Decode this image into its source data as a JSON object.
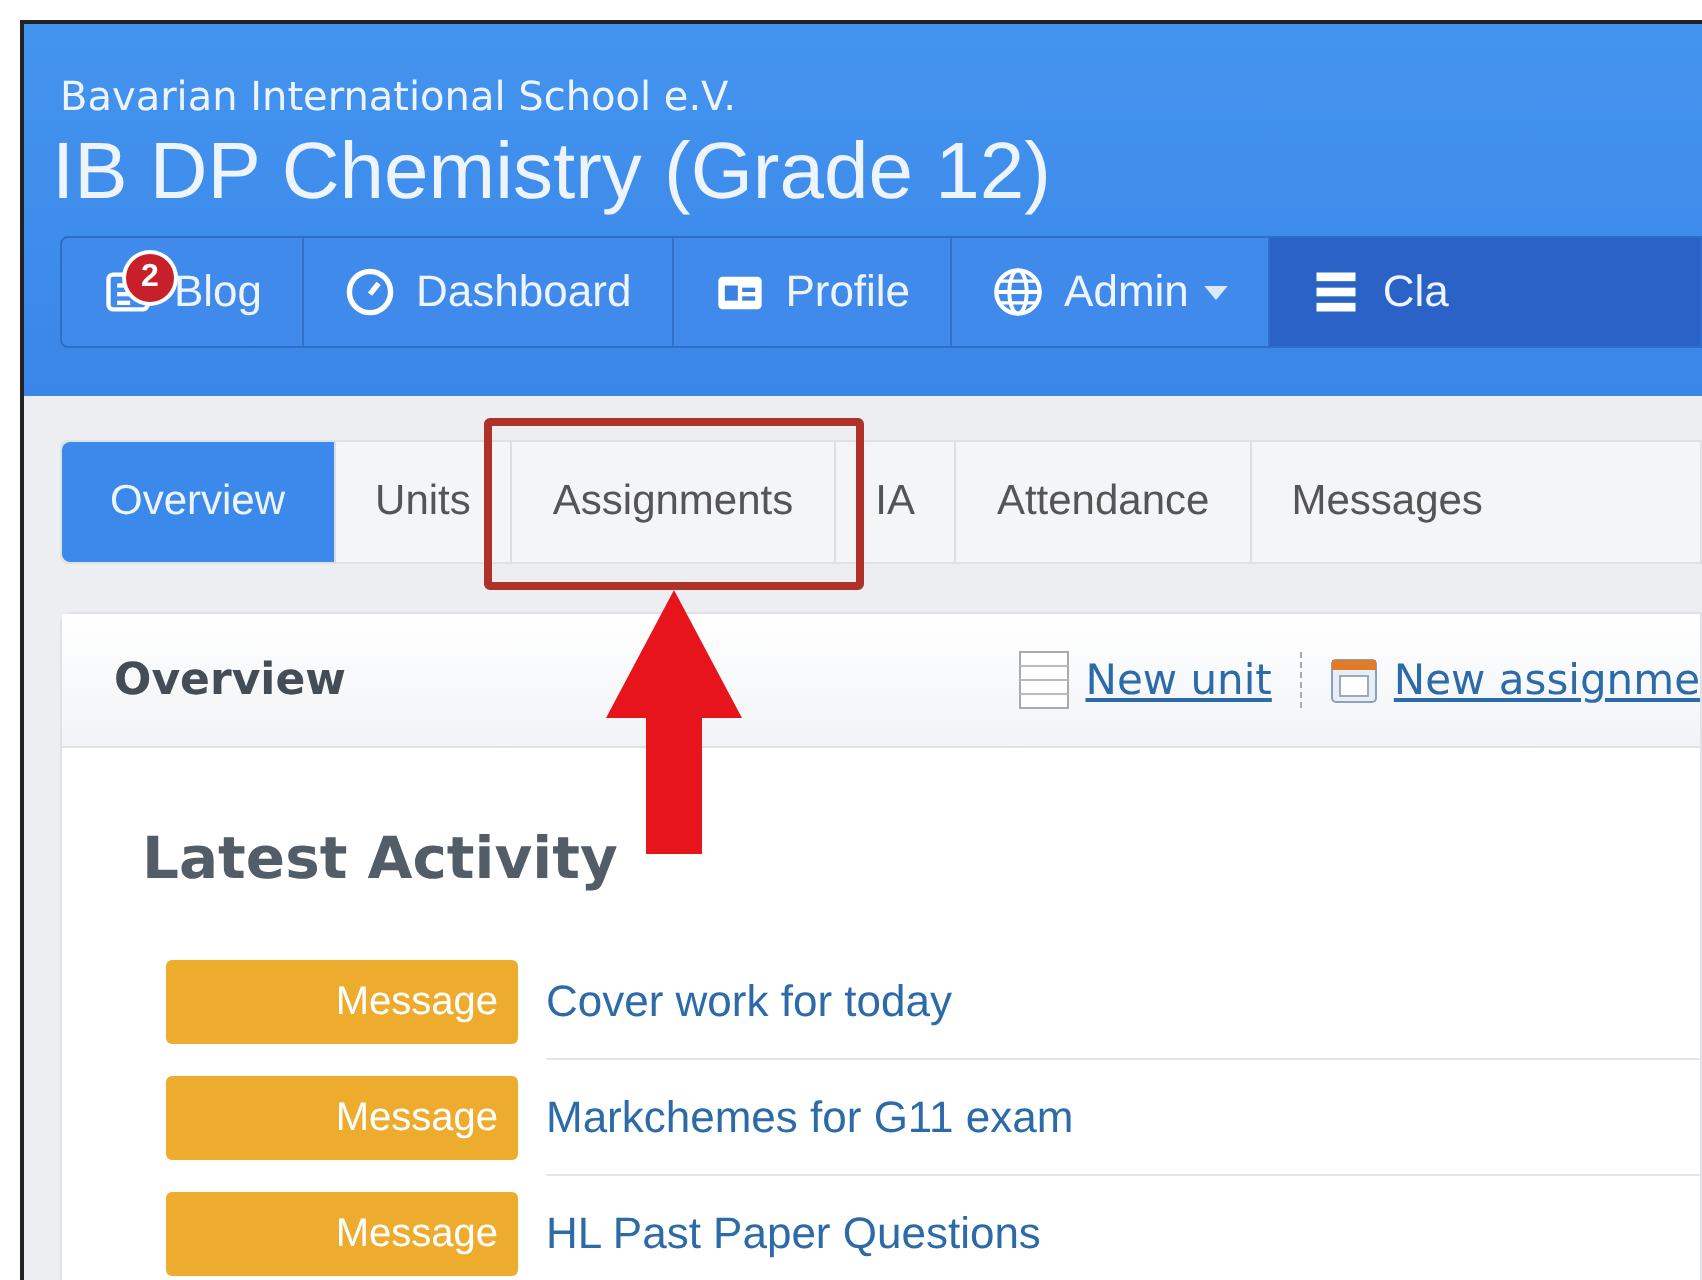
{
  "header": {
    "organization": "Bavarian International School e.V.",
    "title": "IB DP Chemistry (Grade 12)"
  },
  "nav": [
    {
      "kind": "blog",
      "label": "Blog",
      "badge": "2",
      "selected": false
    },
    {
      "kind": "dashboard",
      "label": "Dashboard",
      "selected": false
    },
    {
      "kind": "profile",
      "label": "Profile",
      "selected": false
    },
    {
      "kind": "admin",
      "label": "Admin",
      "dropdown": true,
      "selected": false
    },
    {
      "kind": "class",
      "label": "Cla",
      "selected": true
    }
  ],
  "tabs": [
    {
      "label": "Overview",
      "selected": true
    },
    {
      "label": "Units",
      "selected": false
    },
    {
      "label": "Assignments",
      "selected": false,
      "highlighted": true
    },
    {
      "label": "IA",
      "selected": false
    },
    {
      "label": "Attendance",
      "selected": false
    },
    {
      "label": "Messages",
      "selected": false
    }
  ],
  "panel": {
    "title": "Overview",
    "actions": [
      {
        "kind": "unit",
        "label": "New unit"
      },
      {
        "kind": "assignment",
        "label": "New assignme"
      }
    ]
  },
  "activity": {
    "heading": "Latest Activity",
    "items": [
      {
        "type": "Message",
        "title": "Cover work for today"
      },
      {
        "type": "Message",
        "title": "Markchemes for G11 exam"
      },
      {
        "type": "Message",
        "title": "HL Past Paper Questions"
      }
    ]
  }
}
